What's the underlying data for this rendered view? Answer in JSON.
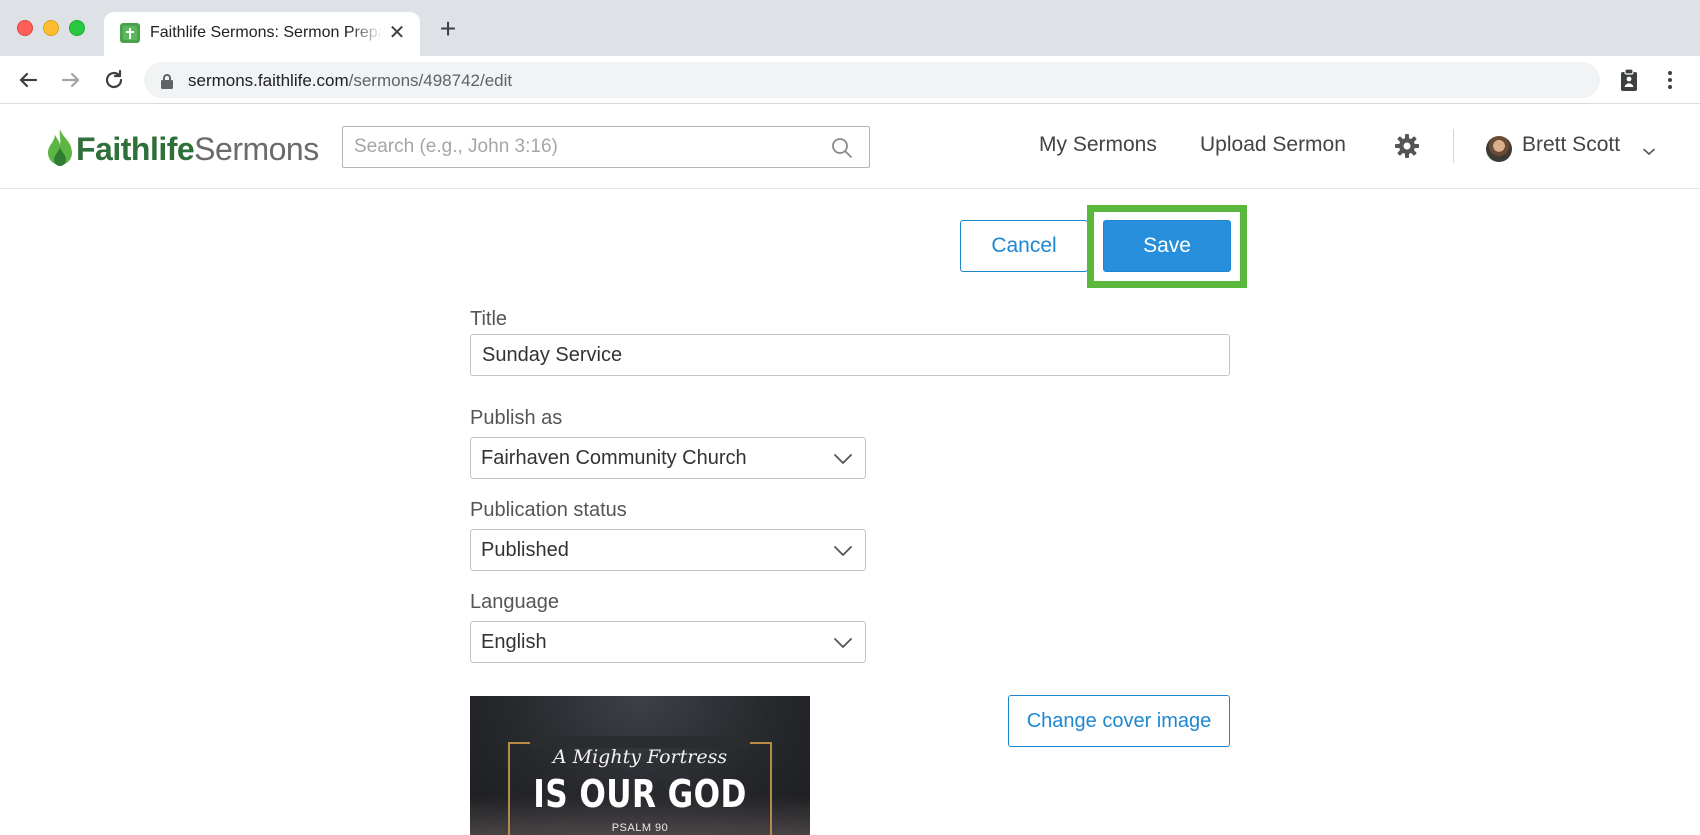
{
  "browser": {
    "tab_title": "Faithlife Sermons: Sermon Preparation",
    "url_host": "sermons.faithlife.com",
    "url_path": "/sermons/498742/edit",
    "new_tab_label": "+",
    "close_tab_label": "✕"
  },
  "header": {
    "logo_primary": "Faithlife",
    "logo_secondary": "Sermons",
    "search_placeholder": "Search (e.g., John 3:16)",
    "nav": {
      "my_sermons": "My Sermons",
      "upload_sermon": "Upload Sermon"
    },
    "user_name": "Brett Scott"
  },
  "actions": {
    "cancel_label": "Cancel",
    "save_label": "Save"
  },
  "form": {
    "title_label": "Title",
    "title_value": "Sunday Service",
    "publish_as_label": "Publish as",
    "publish_as_value": "Fairhaven Community Church",
    "status_label": "Publication status",
    "status_value": "Published",
    "language_label": "Language",
    "language_value": "English",
    "change_cover_label": "Change cover image"
  },
  "cover_image": {
    "line1": "A Mighty Fortress",
    "line2": "IS OUR GOD",
    "line3": "PSALM 90"
  },
  "colors": {
    "accent_blue": "#278fdc",
    "highlight_green": "#5ab83d",
    "logo_green": "#2e6f3a"
  }
}
